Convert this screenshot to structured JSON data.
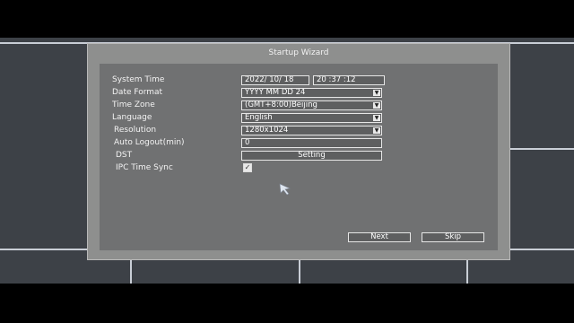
{
  "dialog": {
    "title": "Startup Wizard",
    "fields": {
      "system_time": {
        "label": "System Time",
        "date": "2022/ 10/ 18",
        "time": "20 :37 :12"
      },
      "date_format": {
        "label": "Date Format",
        "value": "YYYY MM DD 24"
      },
      "time_zone": {
        "label": "Time Zone",
        "value": "(GMT+8:00)Beijing"
      },
      "language": {
        "label": "Language",
        "value": "English"
      },
      "resolution": {
        "label": "Resolution",
        "value": "1280x1024"
      },
      "auto_logout": {
        "label": "Auto Logout(min)",
        "value": "0"
      },
      "dst": {
        "label": "DST",
        "button": "Setting"
      },
      "ipc_time_sync": {
        "label": "IPC Time Sync",
        "checked": true
      }
    },
    "buttons": {
      "next": "Next",
      "skip": "Skip"
    }
  },
  "icons": [
    "chevron-down-icon",
    "checkmark-icon",
    "mouse-pointer-icon"
  ]
}
